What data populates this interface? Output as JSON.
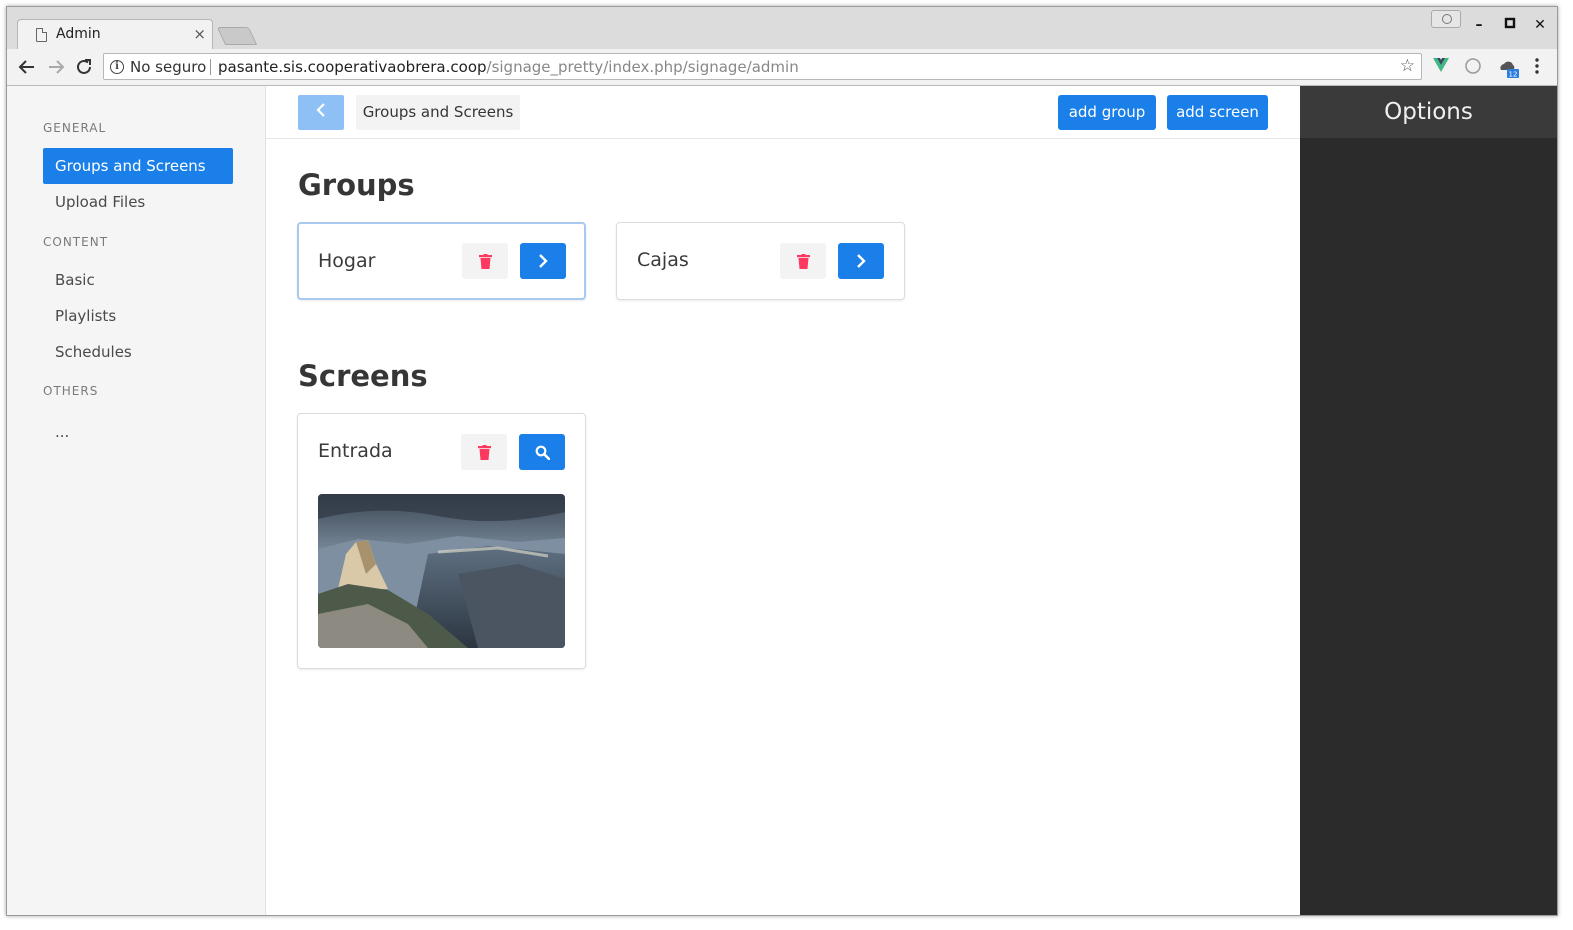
{
  "browser": {
    "tab_title": "Admin",
    "tab_close": "×",
    "security_label": "No seguro",
    "url_host": "pasante.sis.cooperativaobrera.coop",
    "url_path": "/signage_pretty/index.php/signage/admin",
    "extension_badge": "12"
  },
  "sidebar": {
    "sections": [
      {
        "label": "GENERAL",
        "items": [
          {
            "label": "Groups and Screens",
            "active": true
          },
          {
            "label": "Upload Files"
          }
        ]
      },
      {
        "label": "CONTENT",
        "items": [
          {
            "label": "Basic"
          },
          {
            "label": "Playlists"
          },
          {
            "label": "Schedules"
          }
        ]
      },
      {
        "label": "OTHERS",
        "items": [
          {
            "label": "..."
          }
        ]
      }
    ]
  },
  "topbar": {
    "breadcrumb": "Groups and Screens",
    "add_group_label": "add group",
    "add_screen_label": "add screen"
  },
  "groups": {
    "title": "Groups",
    "items": [
      {
        "name": "Hogar"
      },
      {
        "name": "Cajas"
      }
    ]
  },
  "screens": {
    "title": "Screens",
    "items": [
      {
        "name": "Entrada",
        "thumbnail": "mountain-valley-landscape"
      }
    ]
  },
  "options": {
    "title": "Options"
  },
  "colors": {
    "primary": "#1a7fe8",
    "primary_light": "#8fc0f5",
    "danger": "#ff3860",
    "sidebar_bg": "#f5f5f5",
    "options_bg": "#2b2b2b"
  }
}
